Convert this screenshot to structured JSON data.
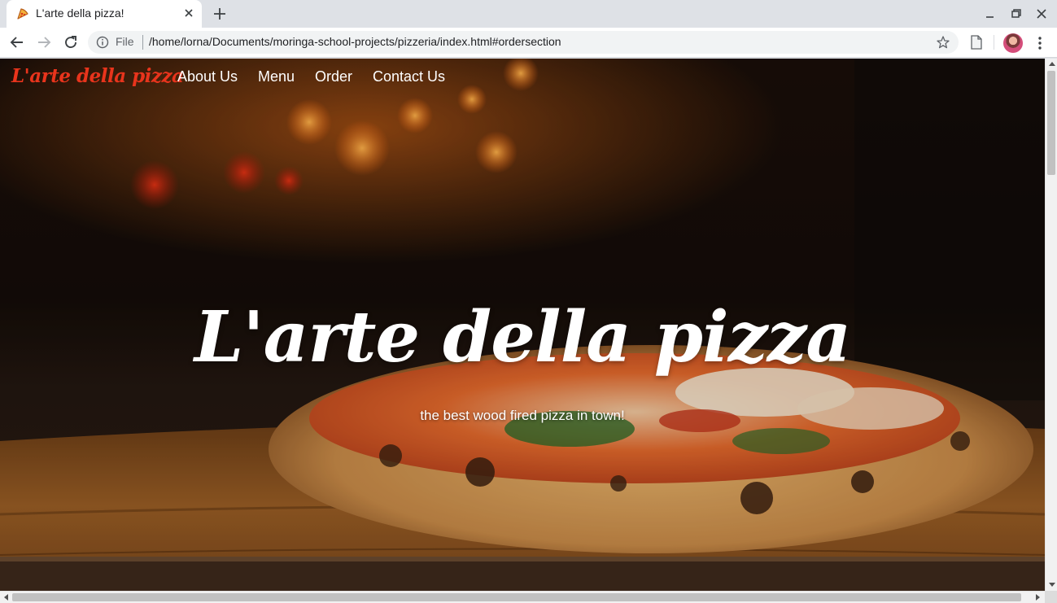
{
  "browser": {
    "tab": {
      "title": "L'arte della pizza!",
      "favicon": "pizza-slice-icon"
    },
    "new_tab_icon": "plus-icon",
    "window_controls": [
      "minimize-icon",
      "restore-icon",
      "close-icon"
    ],
    "toolbar": {
      "back_icon": "arrow-left-icon",
      "forward_icon": "arrow-right-icon",
      "reload_icon": "reload-icon",
      "site_info_icon": "info-icon",
      "scheme_label": "File",
      "url": "/home/lorna/Documents/moringa-school-projects/pizzeria/index.html#ordersection",
      "bookmark_icon": "star-icon",
      "extension_icon": "document-icon",
      "profile_icon": "avatar",
      "menu_icon": "kebab-menu-icon"
    }
  },
  "page": {
    "brand": "L'arte della pizza",
    "nav": [
      {
        "label": "About Us"
      },
      {
        "label": "Menu"
      },
      {
        "label": "Order"
      },
      {
        "label": "Contact Us"
      }
    ],
    "hero": {
      "title": "L'arte della pizza",
      "subtitle": "the best wood fired pizza in town!"
    }
  },
  "colors": {
    "brand": "#e8341c",
    "nav_text": "#ffffff",
    "hero_text": "#ffffff",
    "tab_strip": "#dee1e6",
    "omnibox": "#f1f3f4"
  }
}
